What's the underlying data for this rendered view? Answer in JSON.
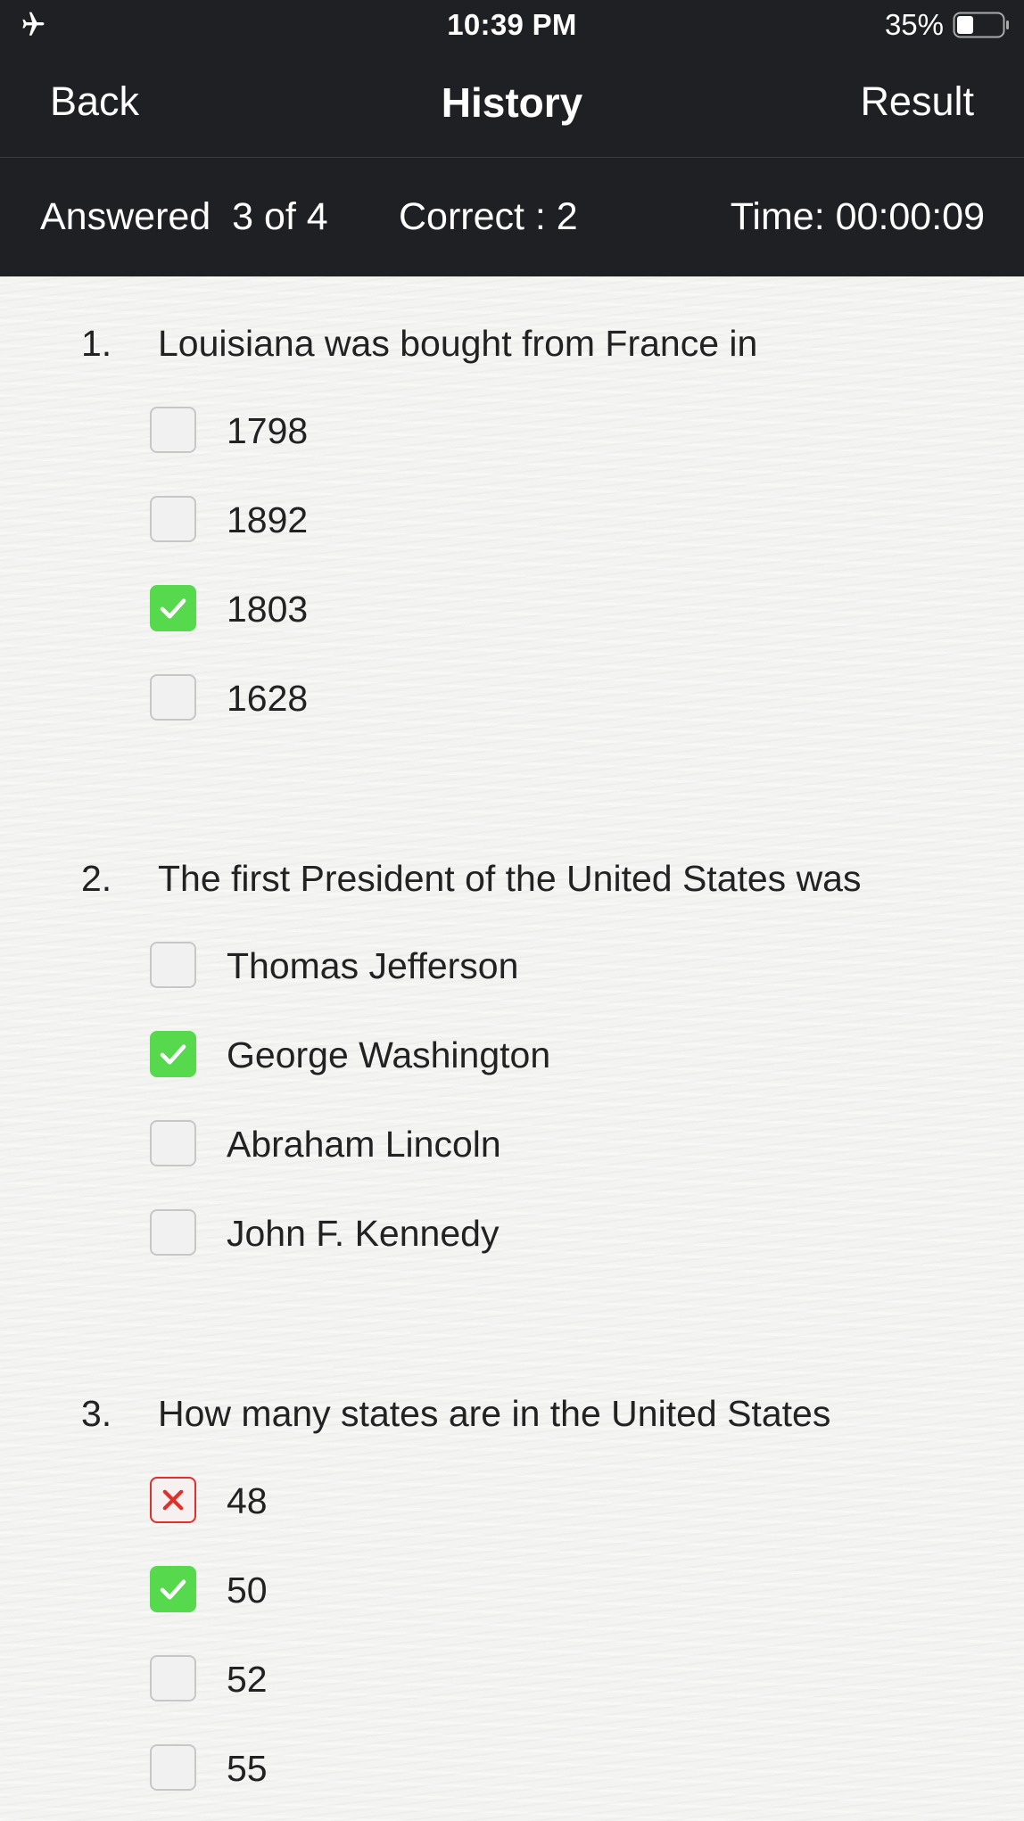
{
  "status_bar": {
    "time": "10:39 PM",
    "battery_percent": "35%",
    "airplane_icon": "airplane-icon",
    "battery_icon": "battery-icon"
  },
  "nav": {
    "back_label": "Back",
    "title": "History",
    "result_label": "Result"
  },
  "summary": {
    "answered": "Answered  3 of 4",
    "correct": "Correct : 2",
    "time": "Time: 00:00:09"
  },
  "colors": {
    "bar_background": "#1f2024",
    "correct_green": "#56d94d",
    "wrong_red": "#e0302a"
  },
  "questions": [
    {
      "number": "1.",
      "text": "Louisiana was bought from France in",
      "options": [
        {
          "label": "1798",
          "state": "none"
        },
        {
          "label": "1892",
          "state": "none"
        },
        {
          "label": "1803",
          "state": "correct"
        },
        {
          "label": "1628",
          "state": "none"
        }
      ]
    },
    {
      "number": "2.",
      "text": "The first President of the United States was",
      "options": [
        {
          "label": "Thomas Jefferson",
          "state": "none"
        },
        {
          "label": "George Washington",
          "state": "correct"
        },
        {
          "label": "Abraham Lincoln",
          "state": "none"
        },
        {
          "label": "John F. Kennedy",
          "state": "none"
        }
      ]
    },
    {
      "number": "3.",
      "text": "How many states are in the United States",
      "options": [
        {
          "label": "48",
          "state": "wrong"
        },
        {
          "label": "50",
          "state": "correct"
        },
        {
          "label": "52",
          "state": "none"
        },
        {
          "label": "55",
          "state": "none"
        }
      ]
    }
  ]
}
